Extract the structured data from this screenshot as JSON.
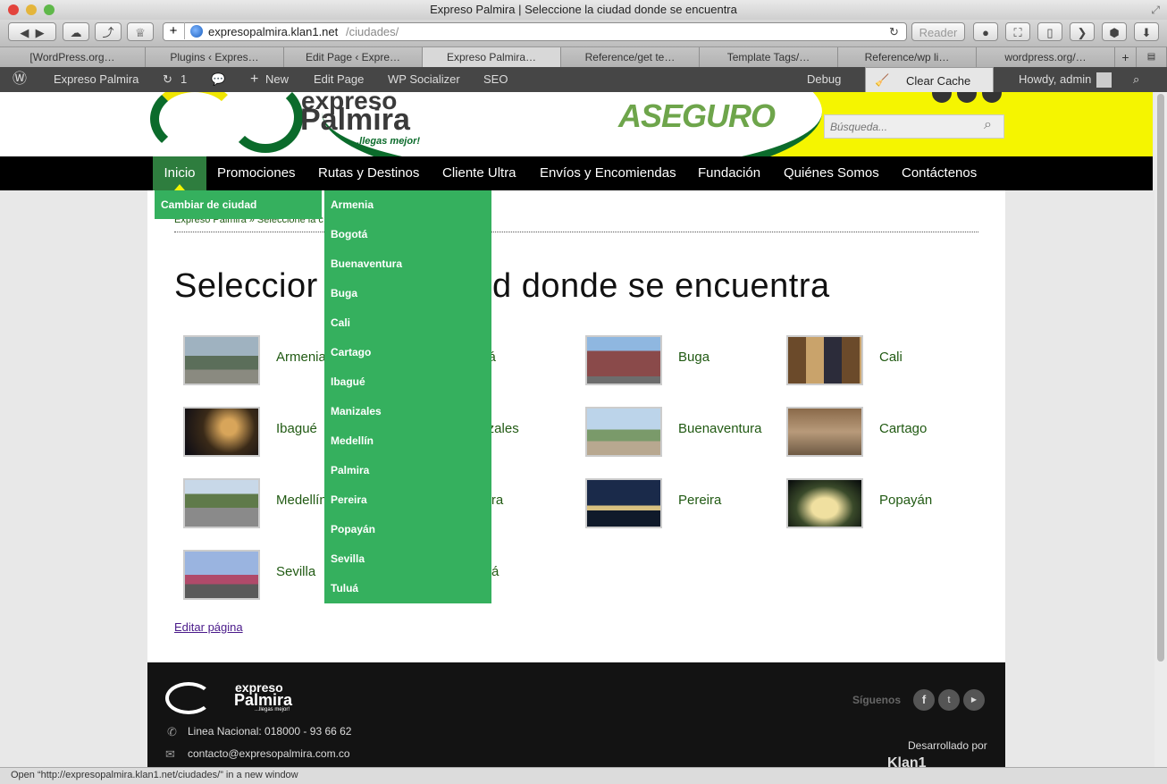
{
  "window": {
    "title": "Expreso Palmira | Seleccione la ciudad donde se encuentra"
  },
  "toolbar": {
    "url_host": "expresopalmira.klan1.net",
    "url_path": "/ciudades/",
    "reader_label": "Reader"
  },
  "tabs": [
    "[WordPress.org…",
    "Plugins ‹ Expres…",
    "Edit Page ‹ Expre…",
    "Expreso Palmira…",
    "Reference/get te…",
    "Template Tags/…",
    "Reference/wp li…",
    "wordpress.org/…"
  ],
  "adminbar": {
    "site_name": "Expreso Palmira",
    "updates_count": "1",
    "new_label": "New",
    "edit_page_label": "Edit Page",
    "wp_socializer_label": "WP Socializer",
    "seo_label": "SEO",
    "debug_label": "Debug",
    "clear_cache_label": "Clear Cache",
    "howdy_label": "Howdy, admin"
  },
  "header": {
    "logo_word1": "expreso",
    "logo_word2": "Palmira",
    "logo_tagline": "...llegas mejor!",
    "promo_text": "ASEGURO",
    "search_placeholder": "Búsqueda..."
  },
  "nav": {
    "items": [
      "Inicio",
      "Promociones",
      "Rutas y Destinos",
      "Cliente Ultra",
      "Envíos y Encomiendas",
      "Fundación",
      "Quiénes Somos",
      "Contáctenos"
    ],
    "submenu_item": "Cambiar de ciudad"
  },
  "dropdown": {
    "items": [
      "Armenia",
      "Bogotá",
      "Buenaventura",
      "Buga",
      "Cali",
      "Cartago",
      "Ibagué",
      "Manizales",
      "Medellín",
      "Palmira",
      "Pereira",
      "Popayán",
      "Sevilla",
      "Tuluá"
    ]
  },
  "content": {
    "breadcrumb": "Expreso Palmira » Seleccione la c",
    "title_left": "Seleccior",
    "title_right": "d donde se encuentra",
    "cities": [
      "Armenia",
      "otá",
      "Buga",
      "Cali",
      "Ibagué",
      "nizales",
      "Buenaventura",
      "Cartago",
      "Medellín",
      "mira",
      "Pereira",
      "Popayán",
      "Sevilla",
      "á"
    ],
    "edit_link": "Editar página"
  },
  "footer": {
    "logo_word1": "expreso",
    "logo_word2": "Palmira",
    "logo_tagline": "...llegas mejor!",
    "phone": "Linea Nacional: 018000 - 93 66 62",
    "email": "contacto@expresopalmira.com.co",
    "follow_label": "Síguenos",
    "developed_label": "Desarrollado por",
    "developer_logo": "Klan1"
  },
  "status": {
    "text": "Open “http://expresopalmira.klan1.net/ciudades/” in a new window"
  },
  "colors": {
    "brand_green": "#35b05e",
    "dark_green": "#0b6b2b",
    "nav_bg": "#000000",
    "header_yellow": "#f5f500",
    "city_link": "#215a13"
  }
}
